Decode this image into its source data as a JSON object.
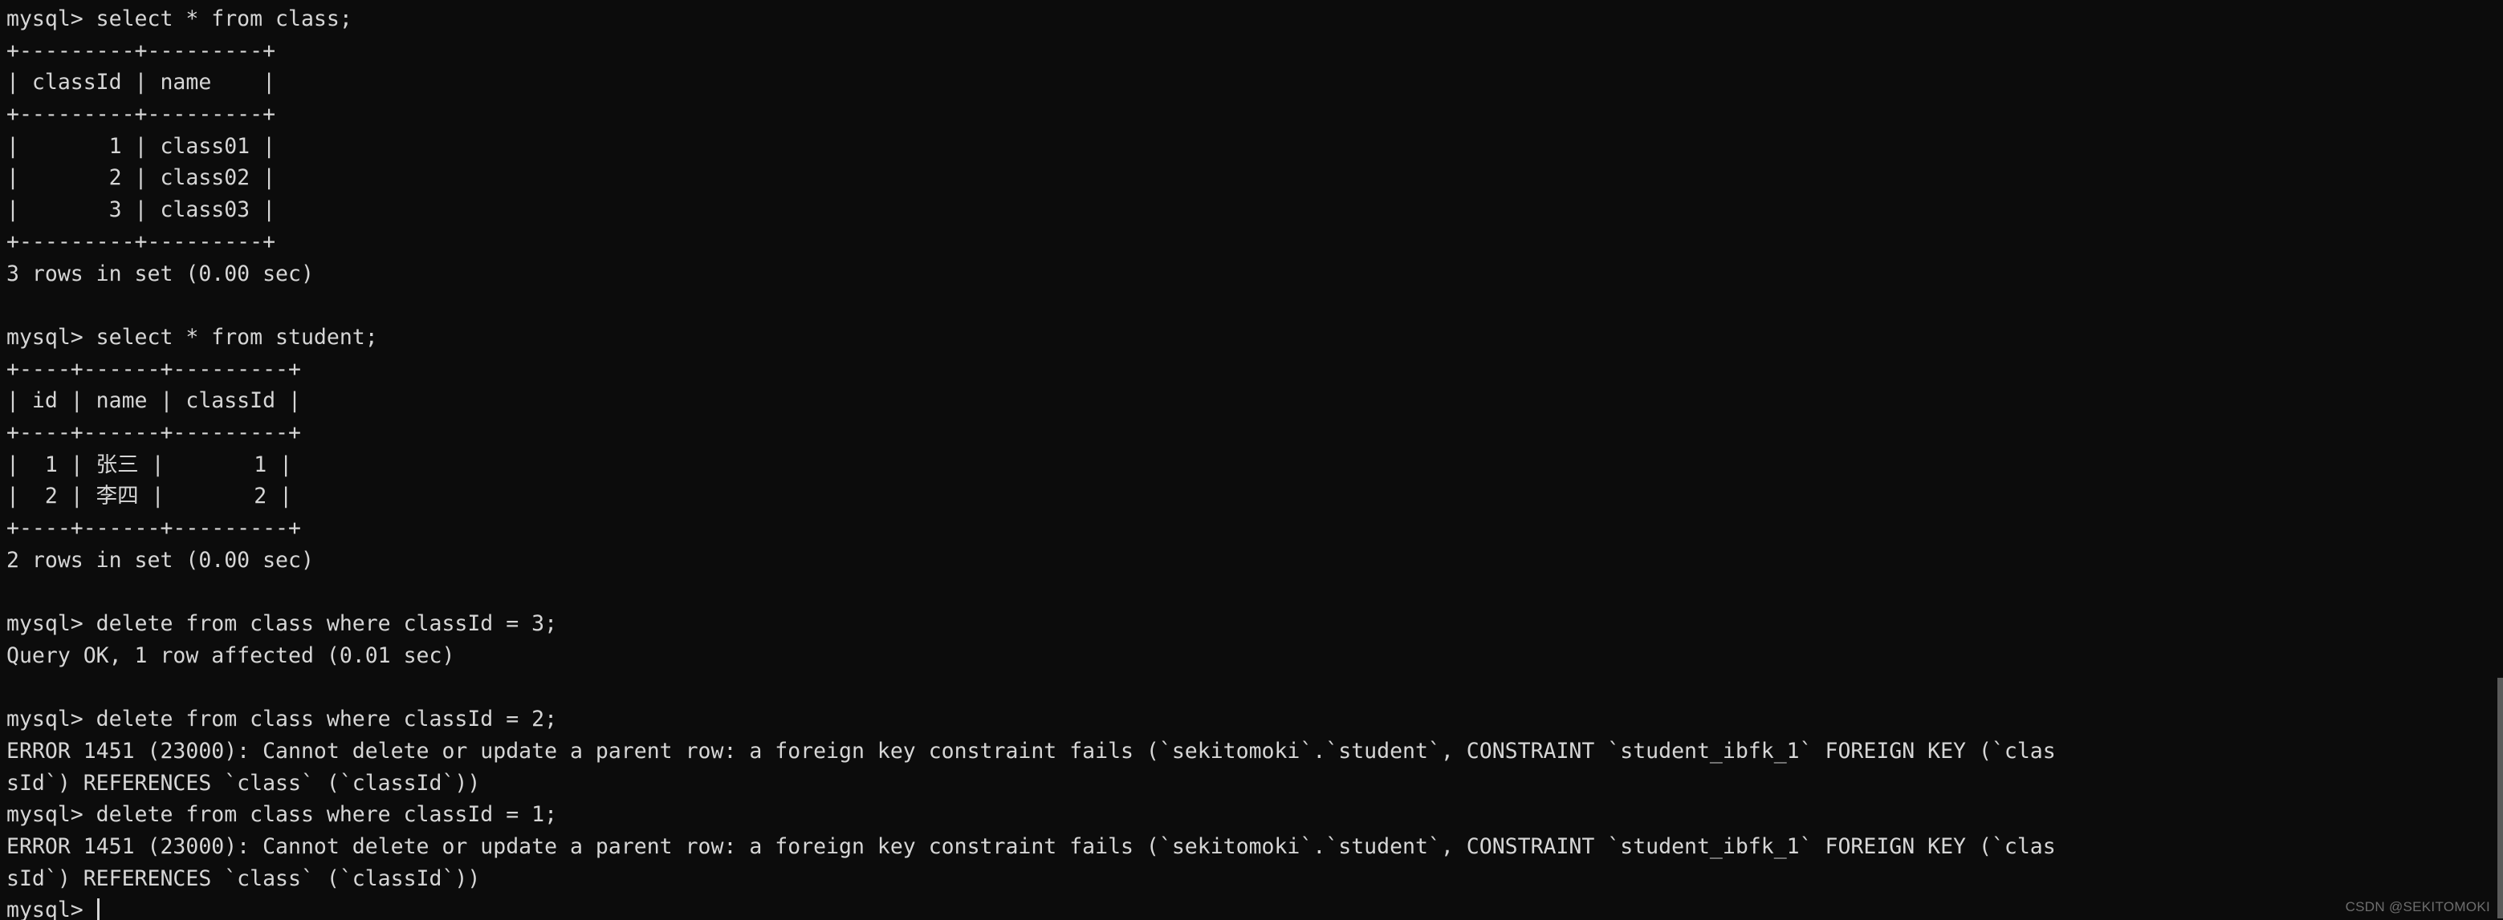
{
  "terminal": {
    "app": "mysql-client-terminal",
    "prompt": "mysql>",
    "background_color": "#0c0c0c",
    "foreground_color": "#d6d6d6",
    "lines": [
      "mysql> select * from class;",
      "+---------+---------+",
      "| classId | name    |",
      "+---------+---------+",
      "|       1 | class01 |",
      "|       2 | class02 |",
      "|       3 | class03 |",
      "+---------+---------+",
      "3 rows in set (0.00 sec)",
      "",
      "mysql> select * from student;",
      "+----+------+---------+",
      "| id | name | classId |",
      "+----+------+---------+",
      "|  1 | 张三 |       1 |",
      "|  2 | 李四 |       2 |",
      "+----+------+---------+",
      "2 rows in set (0.00 sec)",
      "",
      "mysql> delete from class where classId = 3;",
      "Query OK, 1 row affected (0.01 sec)",
      "",
      "mysql> delete from class where classId = 2;",
      "ERROR 1451 (23000): Cannot delete or update a parent row: a foreign key constraint fails (`sekitomoki`.`student`, CONSTRAINT `student_ibfk_1` FOREIGN KEY (`clas",
      "sId`) REFERENCES `class` (`classId`))",
      "mysql> delete from class where classId = 1;",
      "ERROR 1451 (23000): Cannot delete or update a parent row: a foreign key constraint fails (`sekitomoki`.`student`, CONSTRAINT `student_ibfk_1` FOREIGN KEY (`clas",
      "sId`) REFERENCES `class` (`classId`))"
    ],
    "final_prompt": "mysql> ",
    "queries": [
      {
        "command": "select * from class;",
        "result_table": {
          "columns": [
            "classId",
            "name"
          ],
          "rows": [
            [
              "1",
              "class01"
            ],
            [
              "2",
              "class02"
            ],
            [
              "3",
              "class03"
            ]
          ]
        },
        "status": "3 rows in set (0.00 sec)"
      },
      {
        "command": "select * from student;",
        "result_table": {
          "columns": [
            "id",
            "name",
            "classId"
          ],
          "rows": [
            [
              "1",
              "张三",
              "1"
            ],
            [
              "2",
              "李四",
              "2"
            ]
          ]
        },
        "status": "2 rows in set (0.00 sec)"
      },
      {
        "command": "delete from class where classId = 3;",
        "status": "Query OK, 1 row affected (0.01 sec)"
      },
      {
        "command": "delete from class where classId = 2;",
        "status": "ERROR 1451 (23000): Cannot delete or update a parent row: a foreign key constraint fails (`sekitomoki`.`student`, CONSTRAINT `student_ibfk_1` FOREIGN KEY (`classId`) REFERENCES `class` (`classId`))"
      },
      {
        "command": "delete from class where classId = 1;",
        "status": "ERROR 1451 (23000): Cannot delete or update a parent row: a foreign key constraint fails (`sekitomoki`.`student`, CONSTRAINT `student_ibfk_1` FOREIGN KEY (`classId`) REFERENCES `class` (`classId`))"
      }
    ],
    "database": "sekitomoki",
    "error_code": "ERROR 1451 (23000)",
    "constraint_name": "student_ibfk_1"
  },
  "watermark": {
    "text": "CSDN @SEKITOMOKI"
  },
  "scrollbar": {
    "name": "vertical-scrollbar"
  }
}
